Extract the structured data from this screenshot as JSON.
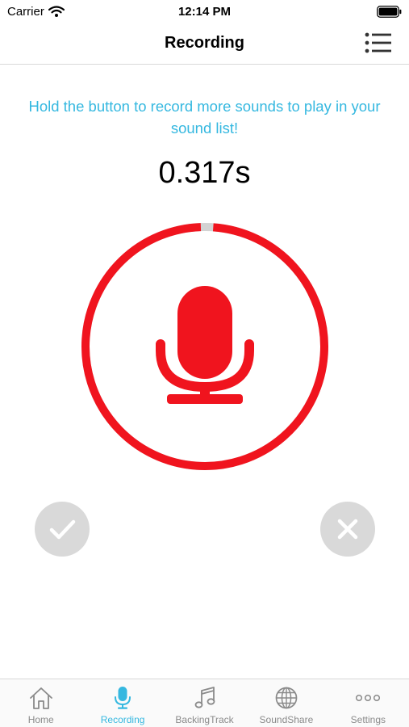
{
  "status_bar": {
    "carrier": "Carrier",
    "time": "12:14 PM",
    "wifi_icon": "wifi-icon",
    "battery_icon": "battery-icon"
  },
  "nav": {
    "title": "Recording",
    "menu_icon": "list-menu-icon"
  },
  "instruction": "Hold the button to record more sounds to play in your sound list!",
  "timer": "0.317s",
  "record": {
    "icon": "microphone-icon",
    "progress": 0.017,
    "color": "#f0141e",
    "track_color": "#d3d3d3"
  },
  "actions": {
    "confirm_icon": "checkmark-icon",
    "cancel_icon": "close-icon",
    "button_color": "#d9d9d9"
  },
  "tabs": [
    {
      "label": "Home",
      "icon": "home-icon",
      "active": false
    },
    {
      "label": "Recording",
      "icon": "microphone-icon",
      "active": true
    },
    {
      "label": "BackingTrack",
      "icon": "music-note-icon",
      "active": false
    },
    {
      "label": "SoundShare",
      "icon": "globe-icon",
      "active": false
    },
    {
      "label": "Settings",
      "icon": "more-dots-icon",
      "active": false
    }
  ],
  "colors": {
    "accent": "#35b8e0",
    "record_red": "#f0141e",
    "inactive_tab": "#8a8a8a"
  }
}
